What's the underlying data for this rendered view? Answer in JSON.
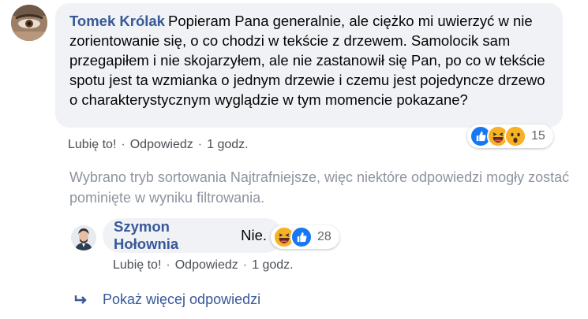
{
  "comment": {
    "author": "Tomek Królak",
    "text": "Popieram Pana generalnie, ale ciężko mi uwierzyć w nie zorientowanie się, o co chodzi w tekście z drzewem. Samolocik sam przegapiłem i nie skojarzyłem, ale nie zastanowił się Pan, po co w tekście spotu jest ta wzmianka o jednym drzewie i czemu jest pojedyncze drzewo o charakterystycznym wyglądzie w tym momencie pokazane?",
    "reactions": {
      "icons": [
        "like-icon",
        "haha-icon",
        "wow-icon"
      ],
      "count": "15"
    },
    "actions": {
      "like": "Lubię to!",
      "reply": "Odpowiedz",
      "time": "1 godz.",
      "separator": "·"
    }
  },
  "filter_notice": "Wybrano tryb sortowania Najtrafniejsze, więc niektóre odpowiedzi mogły zostać pominięte w wyniku filtrowania.",
  "reply": {
    "author": "Szymon Hołownia",
    "text": "Nie.",
    "reactions": {
      "icons": [
        "haha-icon",
        "like-icon"
      ],
      "count": "28"
    },
    "actions": {
      "like": "Lubię to!",
      "reply": "Odpowiedz",
      "time": "1 godz.",
      "separator": "·"
    }
  },
  "show_more": "Pokaż więcej odpowiedzi",
  "colors": {
    "author": "#385898",
    "bubble": "#f0f2f5",
    "muted": "#65676b",
    "like_blue": "#1877f2",
    "emoji_yellow": "#f7b125"
  }
}
